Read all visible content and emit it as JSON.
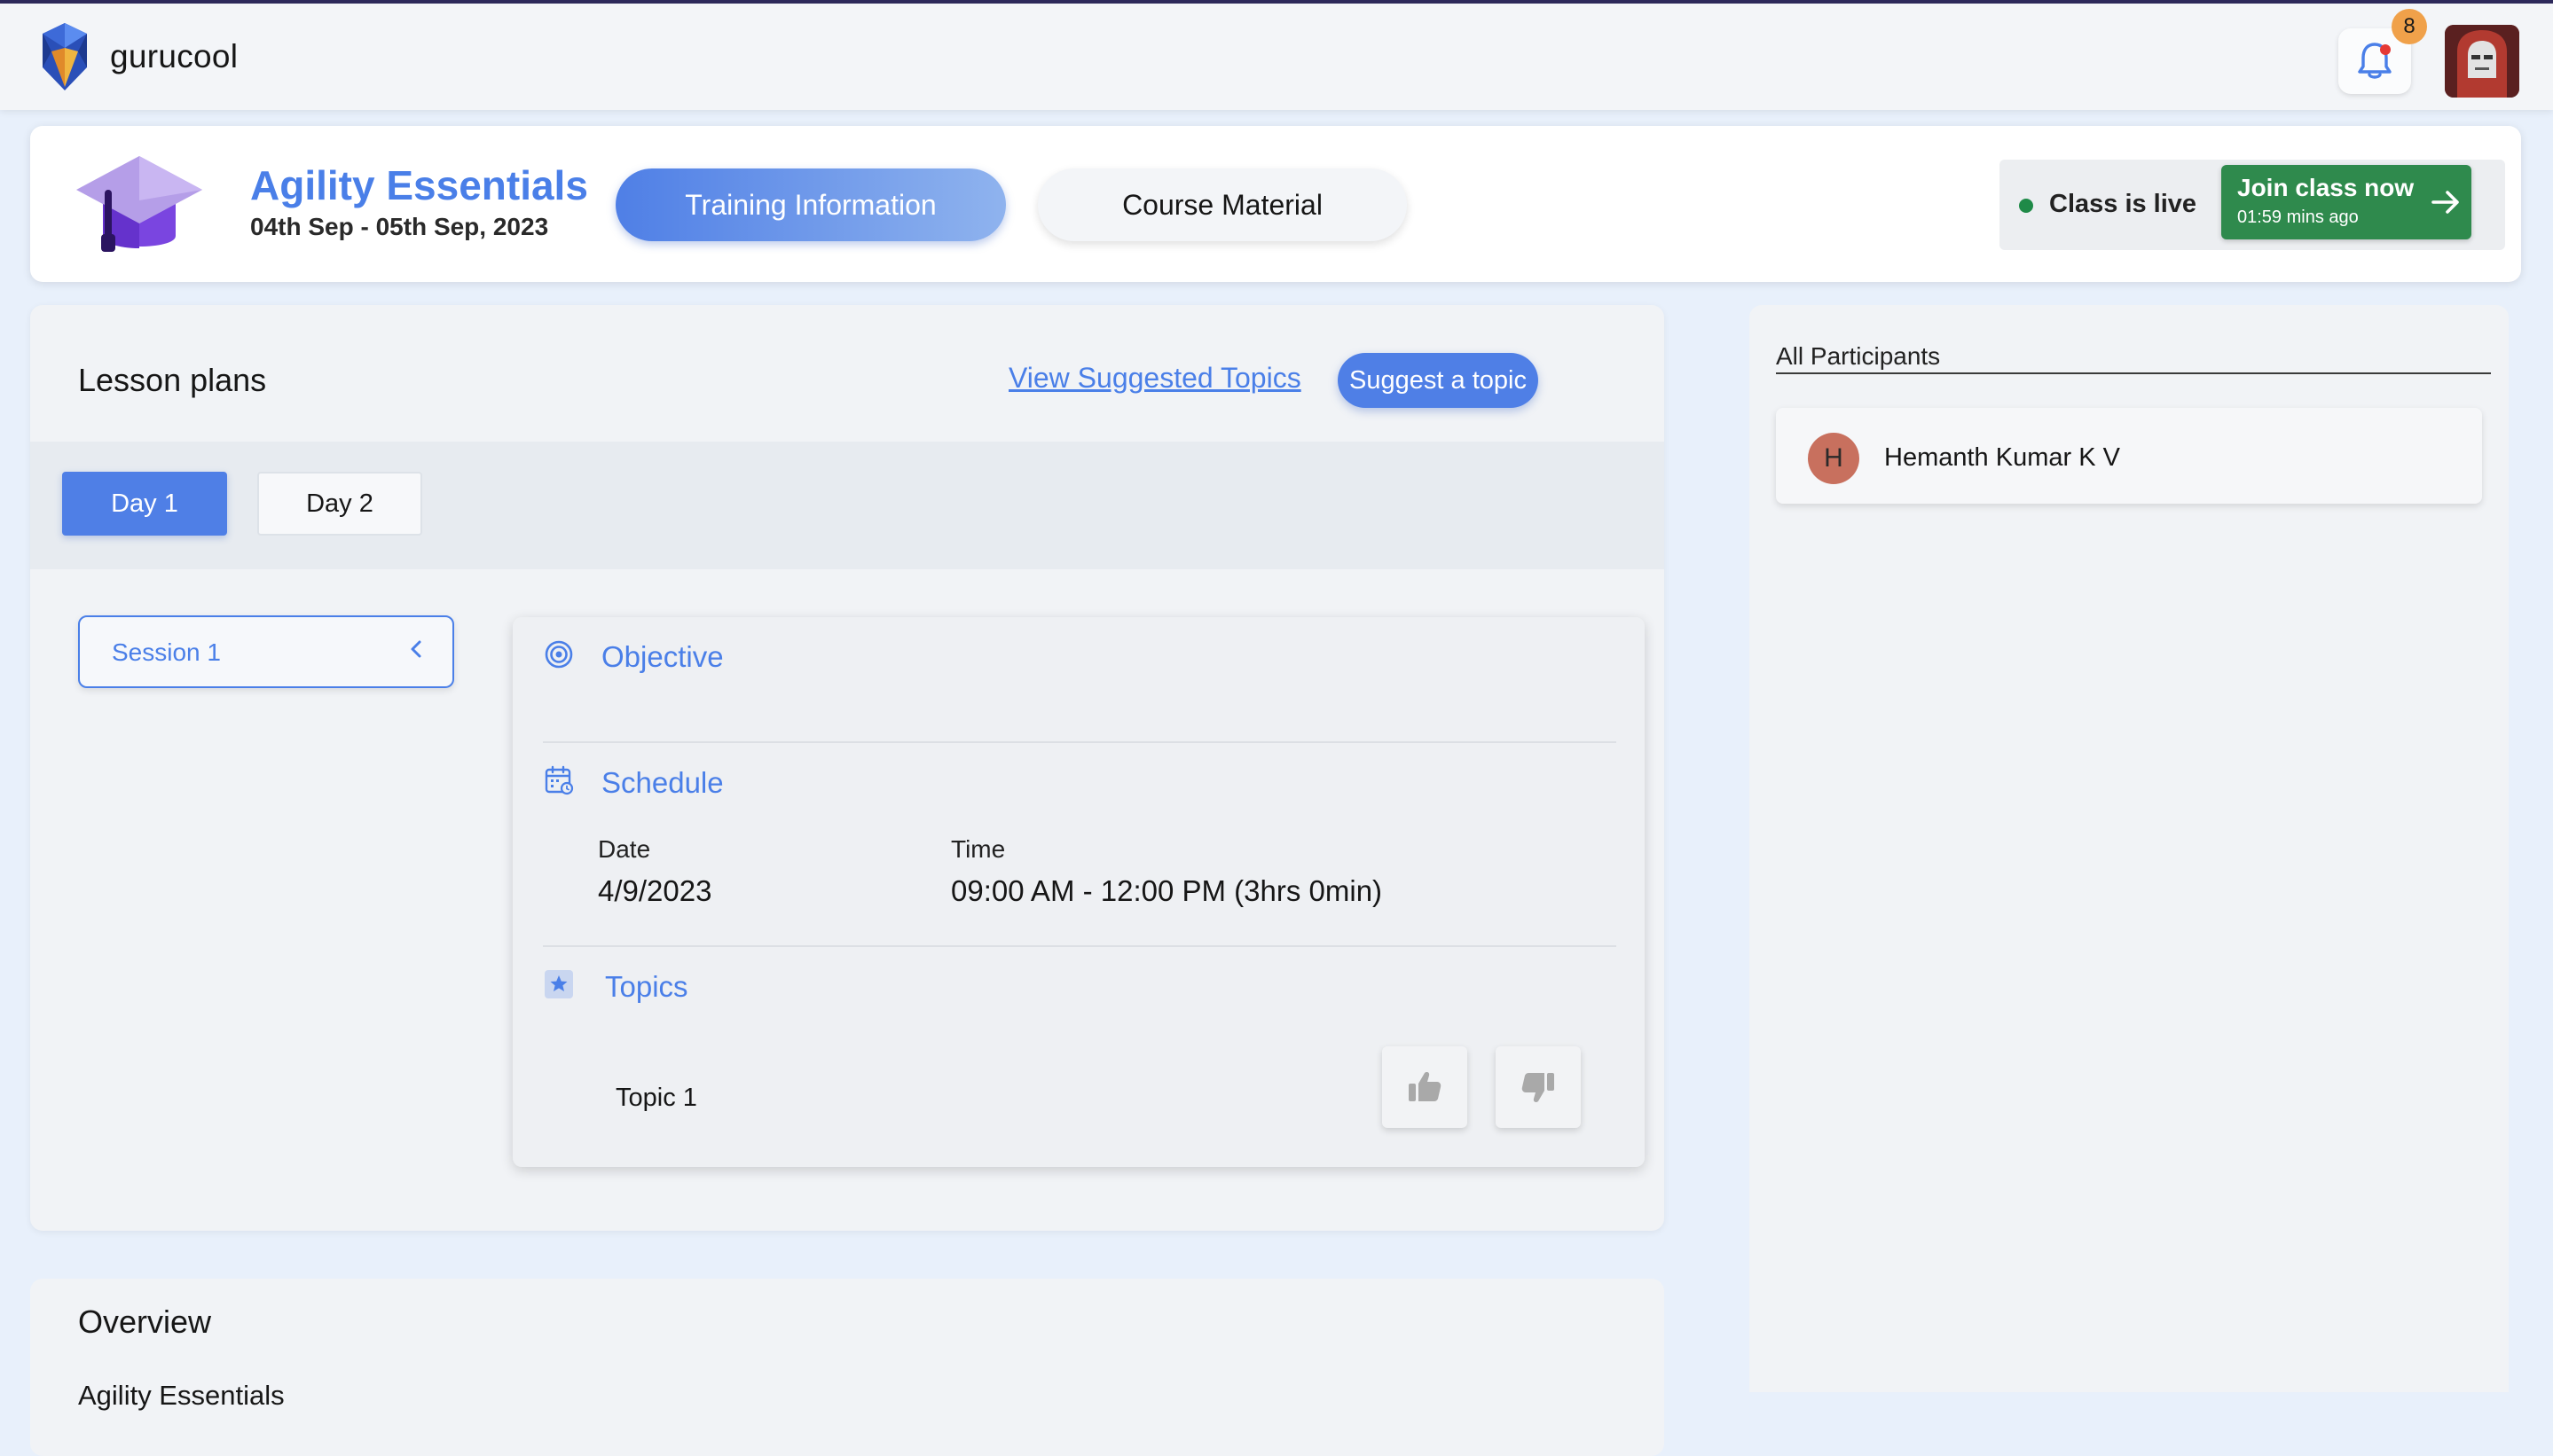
{
  "app": {
    "name": "gurucool",
    "notification_count": "8"
  },
  "course": {
    "title": "Agility Essentials",
    "dates": "04th Sep - 05th Sep, 2023",
    "tabs": [
      {
        "label": "Training Information",
        "active": true
      },
      {
        "label": "Course Material",
        "active": false
      }
    ],
    "live_status": "Class is live",
    "join_label": "Join class now",
    "join_elapsed": "01:59 mins ago"
  },
  "lesson": {
    "title": "Lesson plans",
    "view_topics_label": "View Suggested Topics",
    "suggest_label": "Suggest a topic",
    "days": [
      {
        "label": "Day 1",
        "active": true
      },
      {
        "label": "Day 2",
        "active": false
      }
    ],
    "session_label": "Session 1",
    "objective_title": "Objective",
    "schedule_title": "Schedule",
    "date_label": "Date",
    "date_value": "4/9/2023",
    "time_label": "Time",
    "time_value": "09:00 AM - 12:00 PM (3hrs 0min)",
    "topics_title": "Topics",
    "topics": [
      "Topic 1"
    ]
  },
  "overview": {
    "title": "Overview",
    "course_name": "Agility Essentials"
  },
  "participants": {
    "title": "All Participants",
    "items": [
      {
        "initial": "H",
        "name": "Hemanth Kumar K V"
      }
    ]
  },
  "colors": {
    "accent": "#4a7fe8",
    "live_green": "#2f8a4d",
    "badge_orange": "#f0a14a",
    "avatar_initial_bg": "#c8705e"
  }
}
